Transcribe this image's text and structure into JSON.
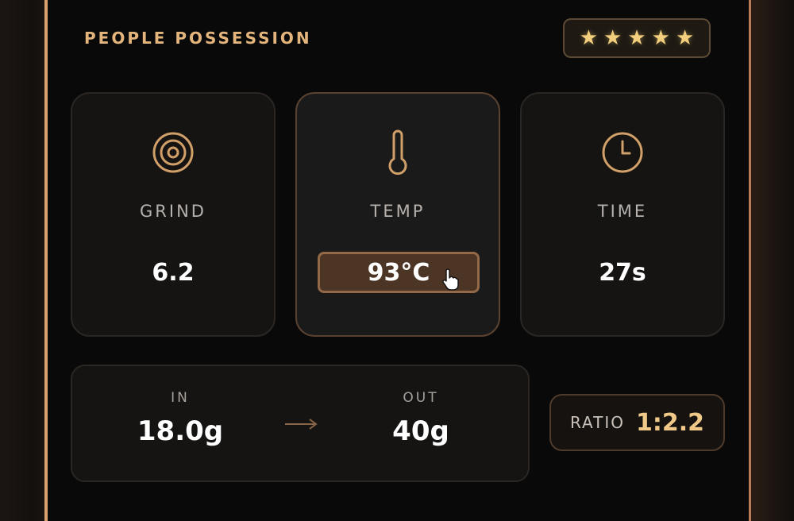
{
  "header": {
    "title": "PEOPLE POSSESSION"
  },
  "rating": {
    "stars": 5,
    "max": 5,
    "glyph": "★"
  },
  "params": [
    {
      "label": "GRIND",
      "value": "6.2",
      "icon": "target-icon"
    },
    {
      "label": "TEMP",
      "value": "93°C",
      "icon": "thermometer-icon",
      "editing": true
    },
    {
      "label": "TIME",
      "value": "27s",
      "icon": "clock-icon"
    }
  ],
  "dose": {
    "in_label": "IN",
    "in_value": "18.0g",
    "arrow": "→",
    "out_label": "OUT",
    "out_value": "40g"
  },
  "ratio": {
    "label": "RATIO",
    "value": "1:2.2"
  },
  "colors": {
    "accent": "#e3b57c",
    "star": "#f3cf7d",
    "ratio_value": "#f0c989",
    "editing_field": "#4d3526"
  }
}
